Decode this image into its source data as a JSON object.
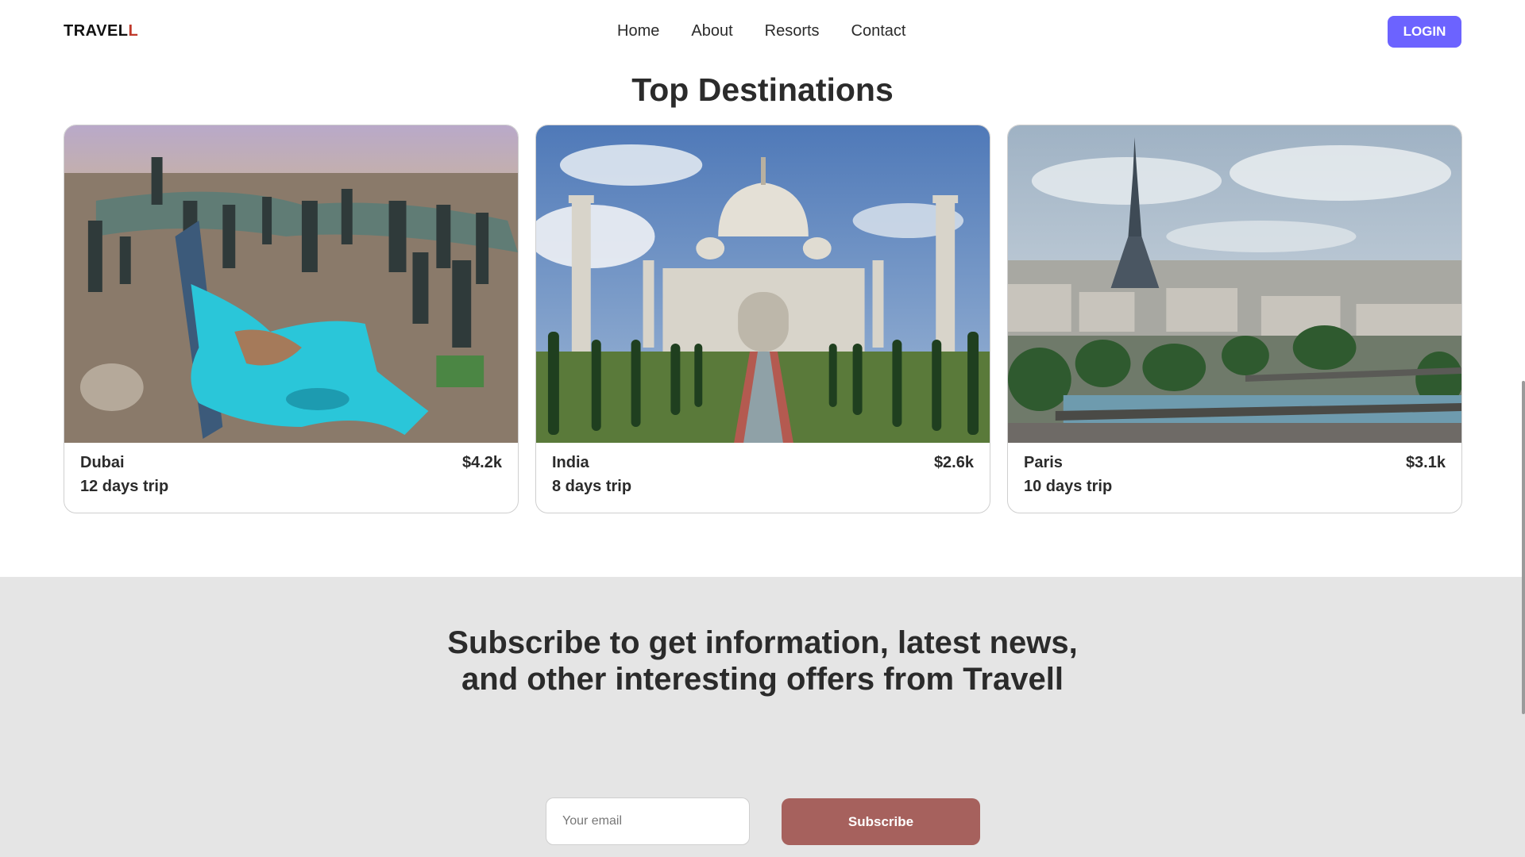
{
  "header": {
    "logo_main": "TRAVEL",
    "logo_accent": "L",
    "nav": [
      {
        "label": "Home"
      },
      {
        "label": "About"
      },
      {
        "label": "Resorts"
      },
      {
        "label": "Contact"
      }
    ],
    "login_label": "LOGIN"
  },
  "destinations": {
    "title": "Top Destinations",
    "cards": [
      {
        "name": "Dubai",
        "price": "$4.2k",
        "days": "12 days trip",
        "image": "dubai-aerial-photo"
      },
      {
        "name": "India",
        "price": "$2.6k",
        "days": "8 days trip",
        "image": "taj-mahal-photo"
      },
      {
        "name": "Paris",
        "price": "$3.1k",
        "days": "10 days trip",
        "image": "eiffel-tower-photo"
      }
    ]
  },
  "subscribe": {
    "title": "Subscribe to get information, latest news, and other interesting offers from Travell",
    "email_placeholder": "Your email",
    "button_label": "Subscribe"
  },
  "colors": {
    "login_bg": "#6c63ff",
    "subscribe_bg": "#a6615d",
    "section_bg": "#e5e5e5",
    "logo_accent": "#c0392b"
  }
}
